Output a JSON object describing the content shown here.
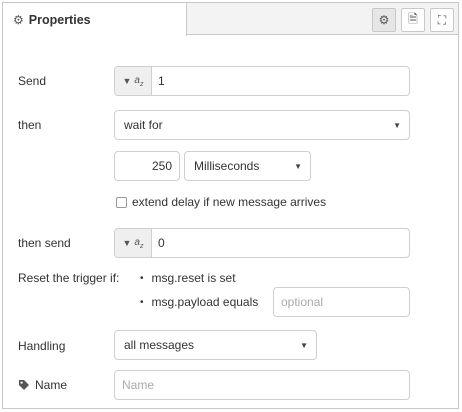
{
  "tab": {
    "icon": "gear-icon",
    "title": "Properties"
  },
  "tab_buttons": [
    {
      "icon": "gear-icon",
      "glyph": "⚙"
    },
    {
      "icon": "document-icon",
      "glyph": "🗎"
    },
    {
      "icon": "frame-icon",
      "glyph": "⛶"
    }
  ],
  "form": {
    "send": {
      "label": "Send",
      "type_marker": "a",
      "type_marker_sub": "z",
      "value": "1"
    },
    "then": {
      "label": "then",
      "selected": "wait for"
    },
    "duration": {
      "value": "250",
      "units": "Milliseconds"
    },
    "extend": {
      "label": "extend delay if new message arrives",
      "checked": false
    },
    "then_send": {
      "label": "then send",
      "type_marker": "a",
      "type_marker_sub": "z",
      "value": "0"
    },
    "reset": {
      "label": "Reset the trigger if:",
      "items": [
        "msg.reset is set",
        "msg.payload equals"
      ],
      "payload_placeholder": "optional"
    },
    "handling": {
      "label": "Handling",
      "selected": "all messages"
    },
    "name": {
      "icon": "tag-icon",
      "label": "Name",
      "placeholder": "Name"
    }
  }
}
